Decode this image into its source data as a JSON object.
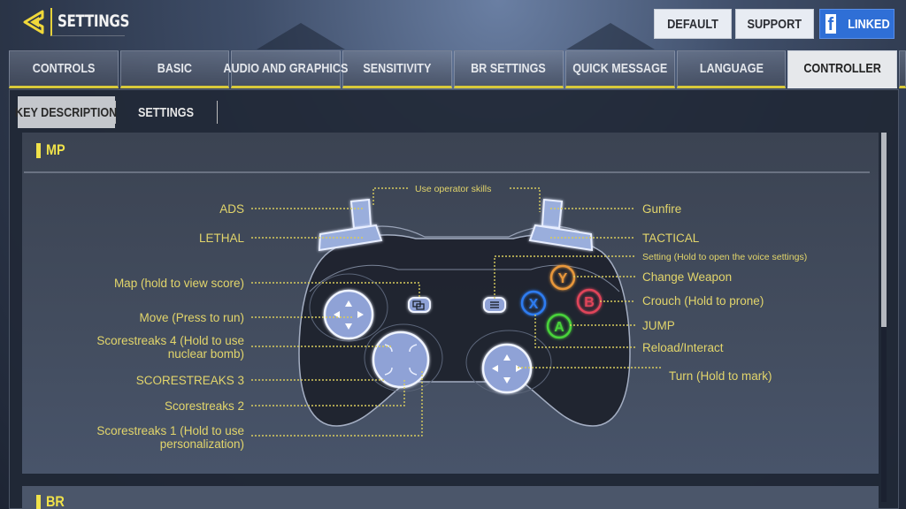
{
  "header": {
    "back_icon": "chevron-left-icon",
    "title": "SETTINGS",
    "buttons": {
      "default": "DEFAULT",
      "support": "SUPPORT",
      "linked": "LINKED",
      "linked_icon": "facebook-icon",
      "linked_icon_glyph": "f"
    }
  },
  "tabs": [
    {
      "label": "CONTROLS",
      "active": false
    },
    {
      "label": "BASIC",
      "active": false
    },
    {
      "label": "AUDIO AND GRAPHICS",
      "active": false
    },
    {
      "label": "SENSITIVITY",
      "active": false
    },
    {
      "label": "BR SETTINGS",
      "active": false
    },
    {
      "label": "QUICK MESSAGE",
      "active": false
    },
    {
      "label": "LANGUAGE",
      "active": false
    },
    {
      "label": "CONTROLLER",
      "active": true
    }
  ],
  "subtabs": [
    {
      "label": "KEY DESCRIPTION",
      "active": true
    },
    {
      "label": "SETTINGS",
      "active": false
    }
  ],
  "sections": [
    {
      "title": "MP"
    },
    {
      "title": "BR"
    }
  ],
  "controller": {
    "buttons": {
      "y": "Y",
      "b": "B",
      "x": "X",
      "a": "A"
    },
    "colors": {
      "y": "#e8973a",
      "b": "#e0455a",
      "x": "#2f7cf0",
      "a": "#48d23a",
      "label": "#e2d56b",
      "body": "#1f232e",
      "accent": "#9aaedc"
    },
    "left_labels": {
      "ads": "ADS",
      "lethal": "LETHAL",
      "map": "Map (hold to view score)",
      "move": "Move (Press to run)",
      "ss4_line1": "Scorestreaks 4 (Hold to use",
      "ss4_line2": "nuclear bomb)",
      "ss3": "SCORESTREAKS 3",
      "ss2": "Scorestreaks 2",
      "ss1_line1": "Scorestreaks 1 (Hold to use",
      "ss1_line2": "personalization)"
    },
    "top_label": "Use operator skills",
    "right_labels": {
      "gunfire": "Gunfire",
      "tactical": "TACTICAL",
      "setting": "Setting (Hold to open the voice settings)",
      "change_weapon": "Change Weapon",
      "crouch": "Crouch (Hold to prone)",
      "jump": "JUMP",
      "reload": "Reload/Interact",
      "turn": "Turn (Hold to mark)"
    }
  }
}
